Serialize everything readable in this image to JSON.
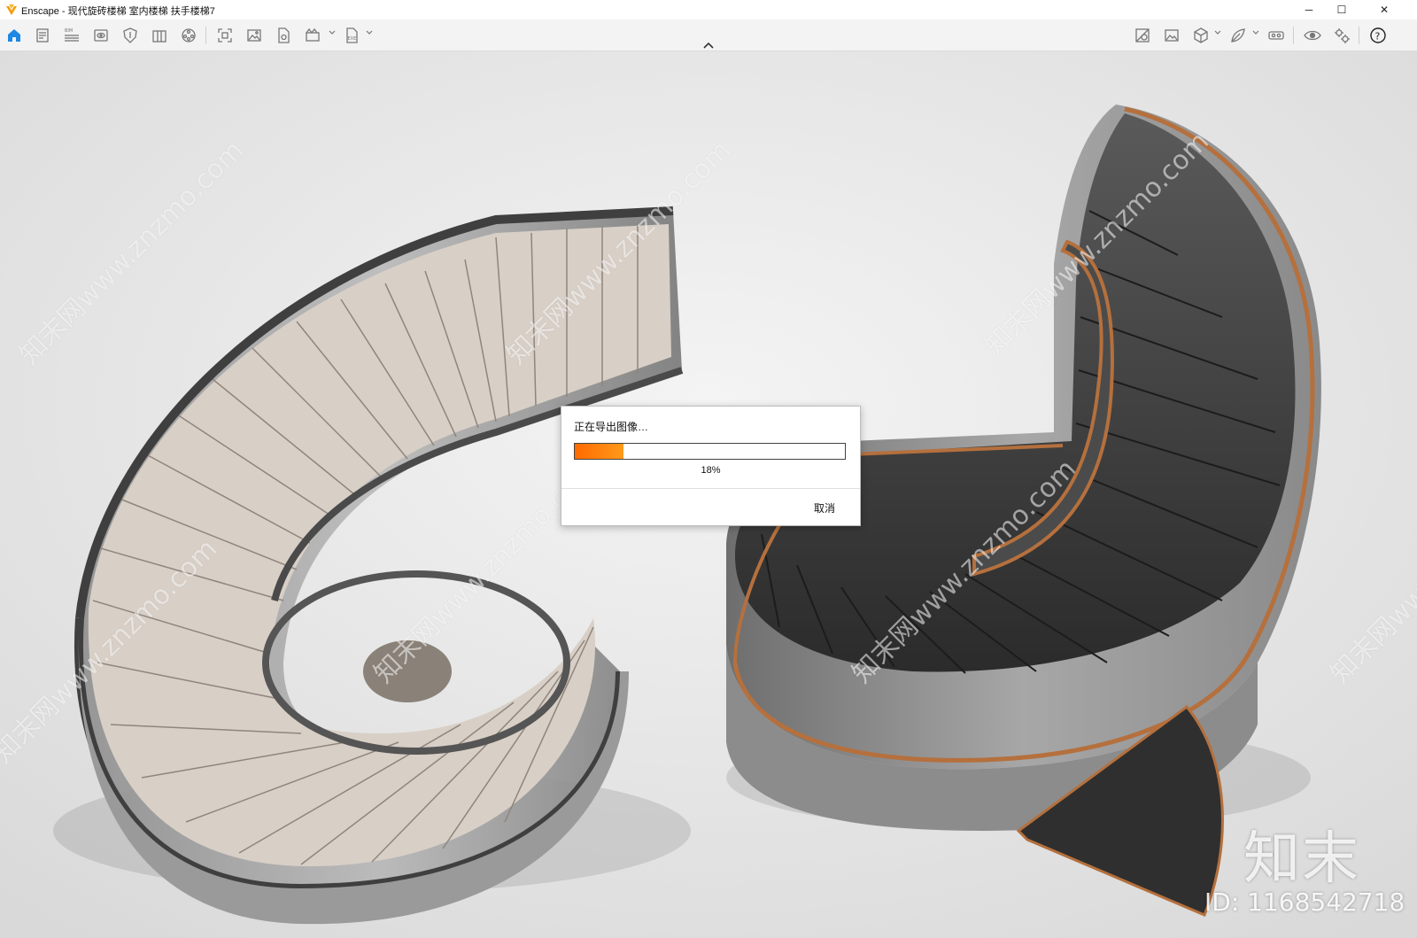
{
  "window": {
    "title": "Enscape - 现代旋砖楼梯 室内楼梯 扶手楼梯7",
    "minimize_glyph": "─",
    "maximize_glyph": "☐",
    "close_glyph": "✕"
  },
  "toolbar": {
    "left_icons": [
      "home-icon",
      "document-icon",
      "bim-icon",
      "view-icon",
      "shield-icon",
      "building-icon",
      "film-reel-icon",
      "screenshot-icon",
      "image-icon",
      "file-export-icon",
      "batch-render-icon",
      "exe-export-icon"
    ],
    "right_icons": [
      "asset-library-icon",
      "material-editor-icon",
      "cube-icon",
      "leaf-icon",
      "vr-headset-icon",
      "visibility-icon",
      "settings-icon",
      "help-icon"
    ],
    "bim_label": "BIM",
    "exe_label": "EXE",
    "help_label": "?"
  },
  "colors": {
    "accent": "#1e88e5",
    "progress": "#ff7a00",
    "toolbar_bg": "#f3f3f3"
  },
  "dialog": {
    "title": "正在导出图像…",
    "progress_percent": 18,
    "progress_label": "18%",
    "cancel_label": "取消"
  },
  "watermark": {
    "text": "知末网www.znzmo.com",
    "logo": "知末",
    "id_text": "ID: 1168542718"
  }
}
